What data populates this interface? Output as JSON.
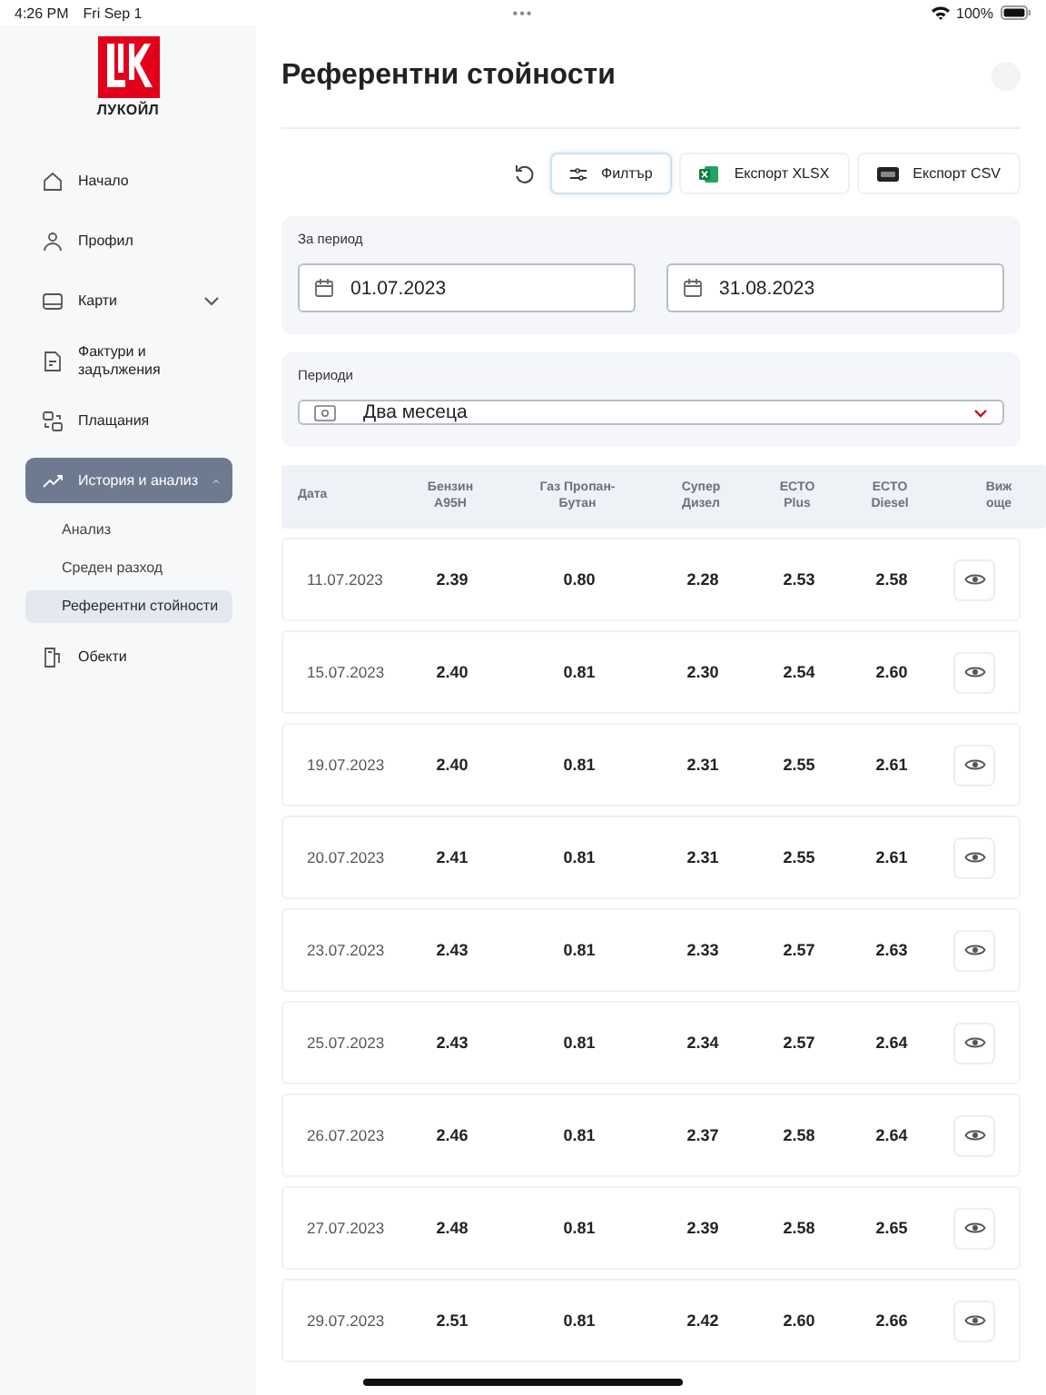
{
  "status_bar": {
    "time": "4:26 PM",
    "date": "Fri Sep 1",
    "dots": "•••",
    "battery": "100%"
  },
  "sidebar": {
    "logo_text": "ЛУКОЙЛ",
    "items": [
      {
        "label": "Начало",
        "kind": "link",
        "selected": false
      },
      {
        "label": "Профил",
        "kind": "link",
        "selected": false
      },
      {
        "label": "Карти",
        "kind": "group",
        "selected": false,
        "expanded": false
      },
      {
        "label": "Фактури и задължения",
        "kind": "link",
        "selected": false
      },
      {
        "label": "Плащания",
        "kind": "link",
        "selected": false
      },
      {
        "label": "История и анализ",
        "kind": "group",
        "selected": true,
        "expanded": true,
        "children": [
          {
            "label": "Анализ",
            "selected": false
          },
          {
            "label": "Среден разход",
            "selected": false
          },
          {
            "label": "Референтни стойности",
            "selected": true
          }
        ]
      },
      {
        "label": "Обекти",
        "kind": "link",
        "selected": false
      }
    ]
  },
  "page": {
    "title": "Референтни стойности"
  },
  "toolbar": {
    "buttons": [
      {
        "label": "Филтър",
        "selected": true
      },
      {
        "label": "Експорт XLSX",
        "selected": false
      },
      {
        "label": "Експорт CSV",
        "selected": false
      }
    ]
  },
  "filters": {
    "period_label": "За период",
    "date_from": "01.07.2023",
    "date_to": "31.08.2023",
    "periods_label": "Периоди",
    "periods_value": "Два месеца"
  },
  "table": {
    "columns": [
      "Дата",
      "Бензин A95H",
      "Газ Пропан-Бутан",
      "Супер Дизел",
      "ECTO Plus",
      "ECTO Diesel",
      "Виж още"
    ],
    "rows": [
      [
        "11.07.2023",
        "2.39",
        "0.80",
        "2.28",
        "2.53",
        "2.58"
      ],
      [
        "15.07.2023",
        "2.40",
        "0.81",
        "2.30",
        "2.54",
        "2.60"
      ],
      [
        "19.07.2023",
        "2.40",
        "0.81",
        "2.31",
        "2.55",
        "2.61"
      ],
      [
        "20.07.2023",
        "2.41",
        "0.81",
        "2.31",
        "2.55",
        "2.61"
      ],
      [
        "23.07.2023",
        "2.43",
        "0.81",
        "2.33",
        "2.57",
        "2.63"
      ],
      [
        "25.07.2023",
        "2.43",
        "0.81",
        "2.34",
        "2.57",
        "2.64"
      ],
      [
        "26.07.2023",
        "2.46",
        "0.81",
        "2.37",
        "2.58",
        "2.64"
      ],
      [
        "27.07.2023",
        "2.48",
        "0.81",
        "2.39",
        "2.58",
        "2.65"
      ],
      [
        "29.07.2023",
        "2.51",
        "0.81",
        "2.42",
        "2.60",
        "2.66"
      ]
    ]
  }
}
